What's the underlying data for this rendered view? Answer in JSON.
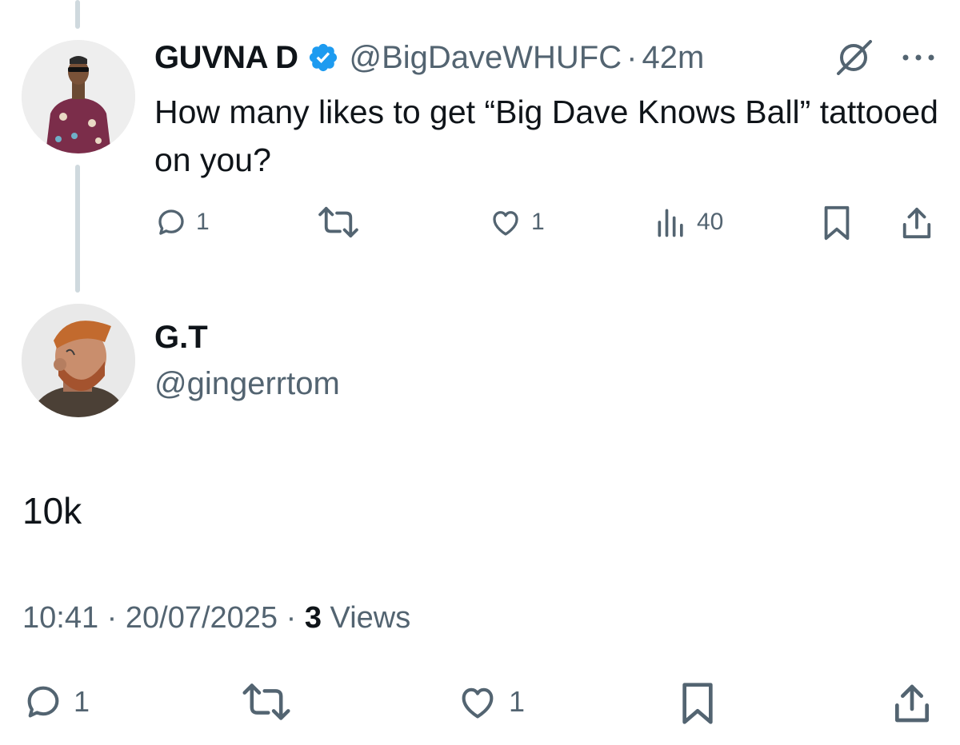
{
  "parent_tweet": {
    "display_name": "GUVNA D",
    "handle": "@BigDaveWHUFC",
    "separator": "·",
    "time": "42m",
    "text": "How many likes to get “Big Dave Knows Ball” tattooed on you?",
    "actions": {
      "replies": "1",
      "likes": "1",
      "views": "40"
    },
    "icons": [
      "verified-badge-icon",
      "grok-icon",
      "more-icon",
      "reply-icon",
      "retweet-icon",
      "like-icon",
      "views-icon",
      "bookmark-icon",
      "share-icon"
    ]
  },
  "reply_tweet": {
    "display_name": "G.T",
    "handle": "@gingerrtom",
    "text": "10k",
    "time": "10:41",
    "date": "20/07/2025",
    "separator": "·",
    "views_count": "3",
    "views_label": "Views",
    "actions": {
      "replies": "1",
      "likes": "1"
    }
  },
  "colors": {
    "text": "#0f1419",
    "secondary": "#536471",
    "verified": "#1d9bf0",
    "thread_line": "#cfd9de"
  }
}
